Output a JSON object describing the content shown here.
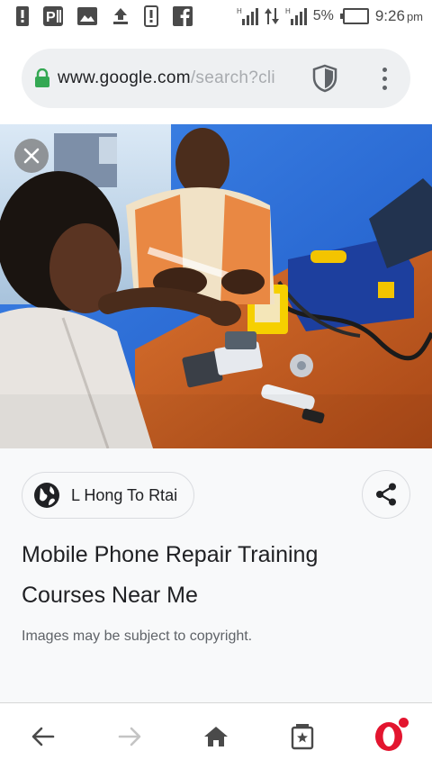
{
  "status_bar": {
    "left_icons": [
      "alert-icon",
      "parking-icon",
      "image-icon",
      "upload-icon",
      "phone-alert-icon",
      "facebook-icon"
    ],
    "right_icons": [
      "signal-h-icon",
      "data-arrows-icon",
      "signal-h-icon",
      "battery-icon"
    ],
    "battery": "5%",
    "time": "9:26",
    "ampm": "pm"
  },
  "browser": {
    "url_host": "www.google.com",
    "url_path": "/search?cli",
    "icons": [
      "lock-icon",
      "shield-icon",
      "more-vert-icon"
    ],
    "lock_color": "#34a853"
  },
  "image_viewer": {
    "photo_description_icon": "photo-image",
    "close_icon": "close-icon"
  },
  "result": {
    "source": "L Hong To Rtai",
    "title": "Mobile Phone Repair Training Courses Near Me",
    "copyright_note": "Images may be subject to copyright.",
    "icons": [
      "globe-icon",
      "share-icon"
    ]
  },
  "bottom_nav": {
    "items": [
      "back-icon",
      "forward-icon",
      "home-icon",
      "tabs-icon",
      "opera-icon"
    ],
    "opera_color": "#e3152f"
  }
}
